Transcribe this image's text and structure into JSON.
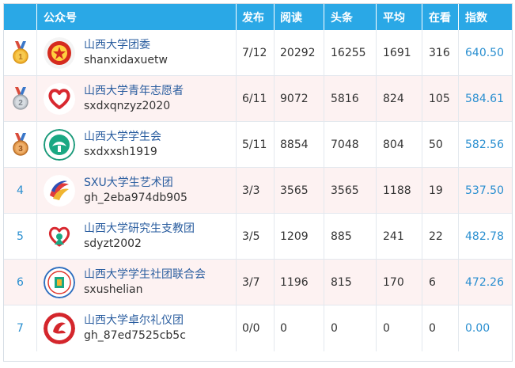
{
  "header": {
    "account": "公众号",
    "publish": "发布",
    "read": "阅读",
    "headline": "头条",
    "average": "平均",
    "watching": "在看",
    "index": "指数"
  },
  "rows": [
    {
      "rank": "1",
      "medal": "gold",
      "logo_icon": "communist-youth-league-logo",
      "name": "山西大学团委",
      "id": "shanxidaxuetw",
      "publish": "7/12",
      "read": "20292",
      "headline": "16255",
      "average": "1691",
      "watching": "316",
      "index": "640.50"
    },
    {
      "rank": "2",
      "medal": "silver",
      "logo_icon": "red-heart-logo",
      "name": "山西大学青年志愿者",
      "id": "sxdxqnzyz2020",
      "publish": "6/11",
      "read": "9072",
      "headline": "5816",
      "average": "824",
      "watching": "105",
      "index": "584.61"
    },
    {
      "rank": "3",
      "medal": "bronze",
      "logo_icon": "student-union-logo",
      "name": "山西大学学生会",
      "id": "sxdxxsh1919",
      "publish": "5/11",
      "read": "8854",
      "headline": "7048",
      "average": "804",
      "watching": "50",
      "index": "582.56"
    },
    {
      "rank": "4",
      "medal": "",
      "logo_icon": "art-troupe-logo",
      "name": "SXU大学生艺术团",
      "id": "gh_2eba974db905",
      "publish": "3/3",
      "read": "3565",
      "headline": "3565",
      "average": "1188",
      "watching": "19",
      "index": "537.50"
    },
    {
      "rank": "5",
      "medal": "",
      "logo_icon": "teaching-volunteer-heart-logo",
      "name": "山西大学研究生支教团",
      "id": "sdyzt2002",
      "publish": "3/5",
      "read": "1209",
      "headline": "885",
      "average": "241",
      "watching": "22",
      "index": "482.78"
    },
    {
      "rank": "6",
      "medal": "",
      "logo_icon": "club-federation-logo",
      "name": "山西大学学生社团联合会",
      "id": "sxushelian",
      "publish": "3/7",
      "read": "1196",
      "headline": "815",
      "average": "170",
      "watching": "6",
      "index": "472.26"
    },
    {
      "rank": "7",
      "medal": "",
      "logo_icon": "etiquette-team-logo",
      "name": "山西大学卓尔礼仪团",
      "id": "gh_87ed7525cb5c",
      "publish": "0/0",
      "read": "0",
      "headline": "0",
      "average": "0",
      "watching": "0",
      "index": "0.00"
    }
  ],
  "colors": {
    "header_bg": "#2aa8e6",
    "alt_row_bg": "#fdf2f2",
    "link_blue": "#2a8fd0",
    "name_blue": "#2a5d9f"
  }
}
